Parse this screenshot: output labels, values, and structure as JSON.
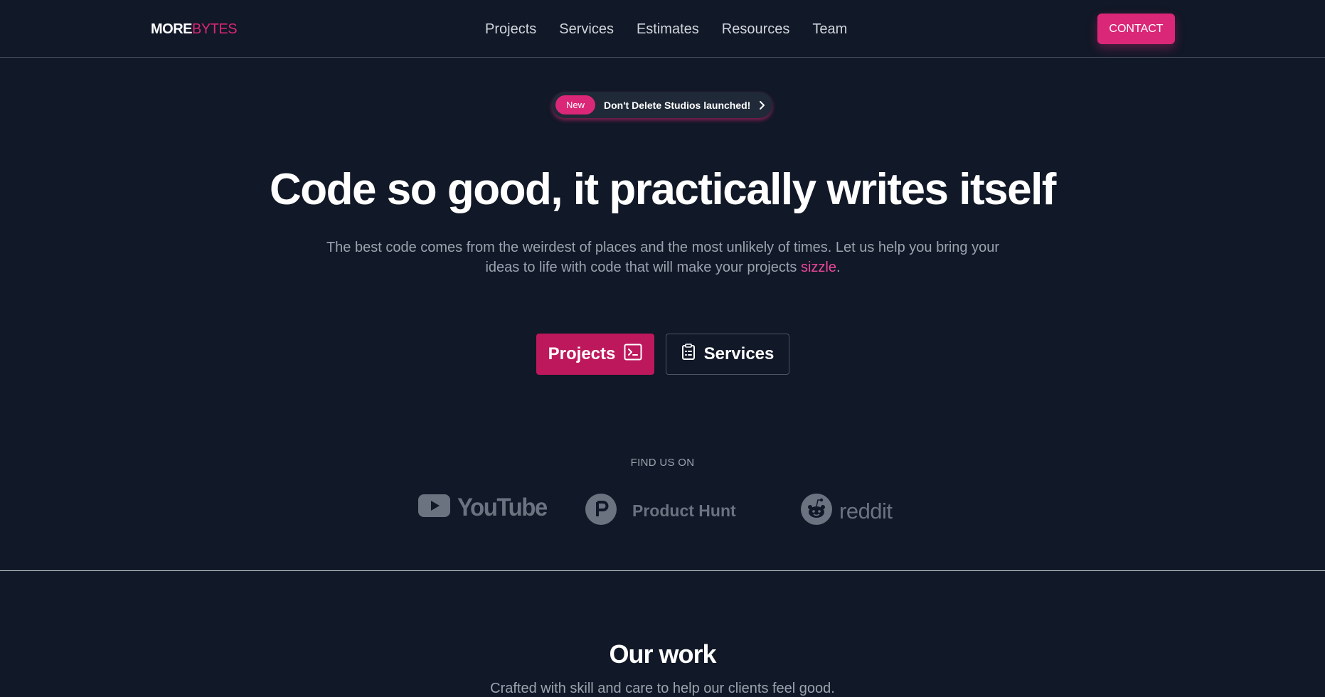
{
  "header": {
    "logo_part1": "MORE",
    "logo_part2": "BYTES",
    "nav": [
      "Projects",
      "Services",
      "Estimates",
      "Resources",
      "Team"
    ],
    "contact_label": "CONTACT"
  },
  "announcement": {
    "badge": "New",
    "text": "Don't Delete Studios launched!",
    "icon": "chevron-right-icon"
  },
  "hero": {
    "title": "Code so good, it practically writes itself",
    "subtitle_before": "The best code comes from the weirdest of places and the most unlikely of times. Let us help you bring your ideas to life with code that will make your projects ",
    "subtitle_highlight": "sizzle",
    "subtitle_after": ".",
    "primary_button": "Projects",
    "primary_icon": "terminal-icon",
    "secondary_button": "Services",
    "secondary_icon": "clipboard-icon"
  },
  "find_us": {
    "label": "FIND US ON",
    "brands": [
      {
        "name": "YouTube",
        "icon": "youtube-icon"
      },
      {
        "name": "Product Hunt",
        "icon": "product-hunt-icon"
      },
      {
        "name": "reddit",
        "icon": "reddit-icon"
      }
    ]
  },
  "work_section": {
    "title": "Our work",
    "subtitle": "Crafted with skill and care to help our clients feel good."
  },
  "colors": {
    "background": "#111827",
    "accent": "#db2777",
    "accent_dark": "#be185d",
    "muted_text": "#9ca3af",
    "logo_gray": "#6b7280"
  }
}
